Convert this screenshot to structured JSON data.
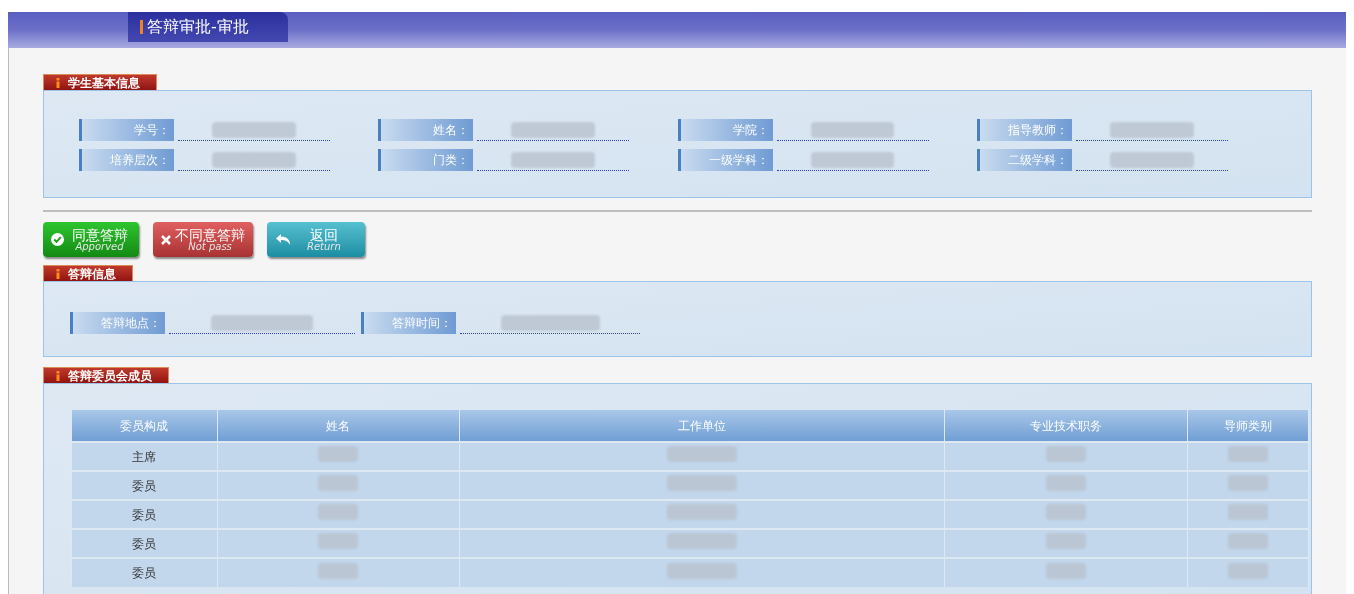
{
  "header": {
    "title": "答辩审批-审批"
  },
  "student_info": {
    "title": "学生基本信息",
    "fields": [
      {
        "label": "学号："
      },
      {
        "label": "姓名："
      },
      {
        "label": "学院："
      },
      {
        "label": "指导教师："
      },
      {
        "label": "培养层次："
      },
      {
        "label": "门类："
      },
      {
        "label": "一级学科："
      },
      {
        "label": "二级学科："
      }
    ]
  },
  "actions": [
    {
      "kind": "approve",
      "label": "同意答辩",
      "sublabel": "Apporved"
    },
    {
      "kind": "reject",
      "label": "不同意答辩",
      "sublabel": "Not pass"
    },
    {
      "kind": "back",
      "label": "返回",
      "sublabel": "Return"
    }
  ],
  "defense_info": {
    "title": "答辩信息",
    "fields": [
      {
        "label": "答辩地点："
      },
      {
        "label": "答辩时间："
      }
    ]
  },
  "committee": {
    "title": "答辩委员会成员",
    "columns": [
      "委员构成",
      "姓名",
      "工作单位",
      "专业技术职务",
      "导师类别"
    ],
    "rows": [
      {
        "role": "主席"
      },
      {
        "role": "委员"
      },
      {
        "role": "委员"
      },
      {
        "role": "委员"
      },
      {
        "role": "委员"
      }
    ]
  }
}
